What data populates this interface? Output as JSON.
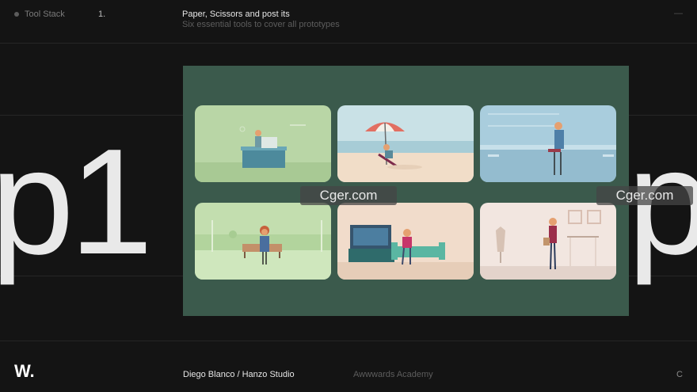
{
  "header": {
    "section_label": "Tool Stack",
    "number": "1.",
    "title": "Paper, Scissors and post its",
    "subtitle": "Six essential tools to cover all prototypes",
    "right_mark": "—"
  },
  "big_text": {
    "left": "p1",
    "right": "p"
  },
  "cards": [
    {
      "scene": "office-desk"
    },
    {
      "scene": "beach-umbrella"
    },
    {
      "scene": "bar-counter"
    },
    {
      "scene": "park-bench"
    },
    {
      "scene": "living-room-sofa"
    },
    {
      "scene": "clothing-store"
    }
  ],
  "watermark": {
    "left": "Cger.com",
    "right": "Cger.com"
  },
  "footer": {
    "logo": "W.",
    "author": "Diego Blanco  /  Hanzo Studio",
    "academy": "Awwwards Academy",
    "right_letter": "C"
  },
  "colors": {
    "background": "#141414",
    "panel": "#3b5a4c"
  }
}
